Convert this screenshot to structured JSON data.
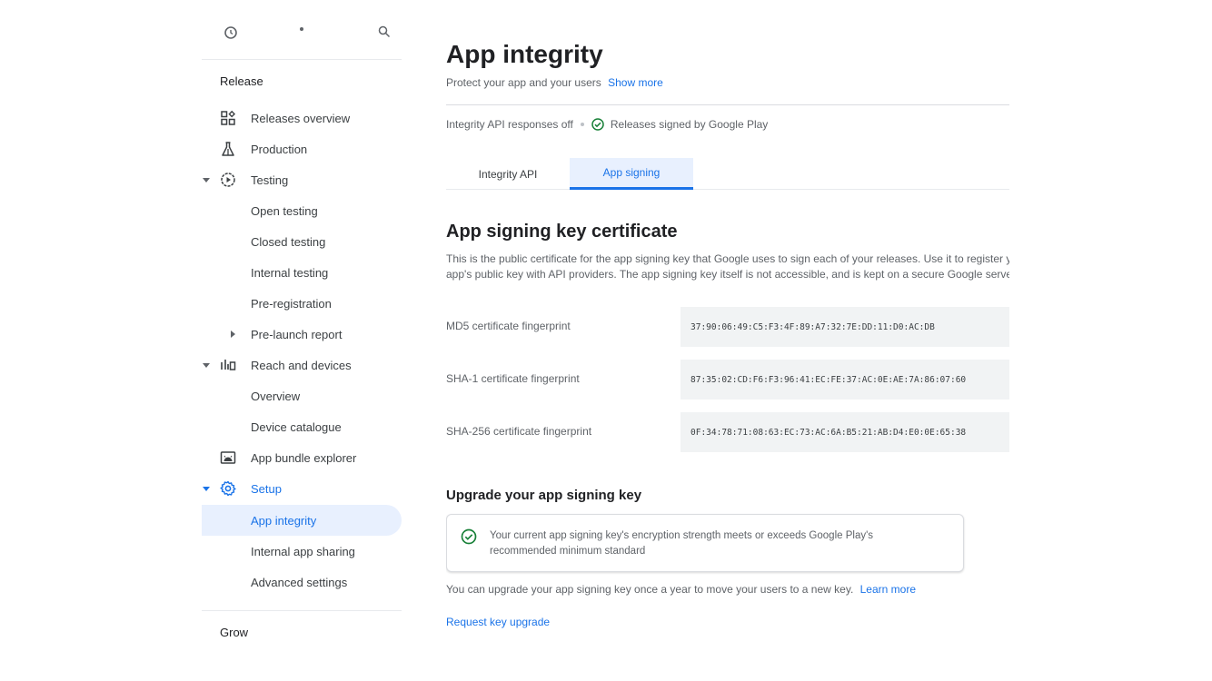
{
  "colors": {
    "accent": "#1a73e8",
    "active_bg": "#e8f0fe",
    "success": "#188038"
  },
  "sidebar": {
    "release_section": "Release",
    "grow_section": "Grow",
    "items": [
      {
        "label": "Releases overview",
        "icon": "dashboard-icon"
      },
      {
        "label": "Production",
        "icon": "flask-icon"
      },
      {
        "label": "Testing",
        "icon": "play-circle-icon"
      },
      {
        "label": "Open testing"
      },
      {
        "label": "Closed testing"
      },
      {
        "label": "Internal testing"
      },
      {
        "label": "Pre-registration"
      },
      {
        "label": "Pre-launch report"
      },
      {
        "label": "Reach and devices",
        "icon": "bar-chart-icon"
      },
      {
        "label": "Overview"
      },
      {
        "label": "Device catalogue"
      },
      {
        "label": "App bundle explorer",
        "icon": "android-box-icon"
      },
      {
        "label": "Setup",
        "icon": "gear-icon"
      },
      {
        "label": "App integrity"
      },
      {
        "label": "Internal app sharing"
      },
      {
        "label": "Advanced settings"
      }
    ]
  },
  "header": {
    "title": "App integrity",
    "subtitle": "Protect your app and your users",
    "show_more": "Show more"
  },
  "status": {
    "integrity": "Integrity API responses off",
    "signed": "Releases signed by Google Play"
  },
  "tabs": [
    {
      "label": "Integrity API",
      "selected": false
    },
    {
      "label": "App signing",
      "selected": true
    }
  ],
  "certificate": {
    "title": "App signing key certificate",
    "description": "This is the public certificate for the app signing key that Google uses to sign each of your releases. Use it to register your app's public key with API providers. The app signing key itself is not accessible, and is kept on a secure Google server.",
    "fingerprints": [
      {
        "label": "MD5 certificate fingerprint",
        "value": "37:90:06:49:C5:F3:4F:89:A7:32:7E:DD:11:D0:AC:DB"
      },
      {
        "label": "SHA-1 certificate fingerprint",
        "value": "87:35:02:CD:F6:F3:96:41:EC:FE:37:AC:0E:AE:7A:86:07:60"
      },
      {
        "label": "SHA-256 certificate fingerprint",
        "value": "0F:34:78:71:08:63:EC:73:AC:6A:B5:21:AB:D4:E0:0E:65:38"
      }
    ]
  },
  "upgrade": {
    "title": "Upgrade your app signing key",
    "notice": "Your current app signing key's encryption strength meets or exceeds Google Play's recommended minimum standard",
    "text": "You can upgrade your app signing key once a year to move your users to a new key.",
    "learn_more": "Learn more",
    "request": "Request key upgrade"
  }
}
